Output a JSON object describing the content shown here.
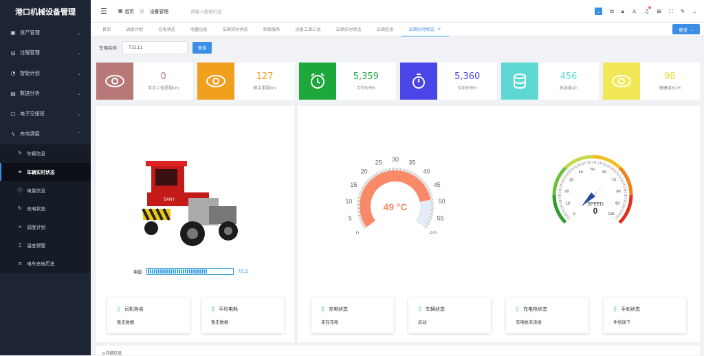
{
  "sidebar": {
    "logo": "港口机械设备管理",
    "menus": [
      {
        "label": "资产管理",
        "icon": "asset-icon",
        "chev": "⌄"
      },
      {
        "label": "过程管理",
        "icon": "process-icon",
        "chev": "⌄"
      },
      {
        "label": "智能计划",
        "icon": "plan-icon",
        "chev": "⌄"
      },
      {
        "label": "数据分析",
        "icon": "chart-icon",
        "chev": "⌄"
      },
      {
        "label": "电子交接班",
        "icon": "shift-icon",
        "chev": "⌄"
      },
      {
        "label": "充电调度",
        "icon": "charge-icon",
        "chev": "⌃"
      }
    ],
    "subs": [
      {
        "label": "车辆信息",
        "icon": "edit-icon"
      },
      {
        "label": "车辆实时状态",
        "icon": "glasses-icon"
      },
      {
        "label": "电量信息",
        "icon": "info-icon"
      },
      {
        "label": "充电状态",
        "icon": "refresh-icon"
      },
      {
        "label": "调度计划",
        "icon": "send-icon"
      },
      {
        "label": "温度预警",
        "icon": "bell-icon"
      },
      {
        "label": "电车充电历史",
        "icon": "list-icon"
      }
    ]
  },
  "topbar": {
    "crumb_home": "首页",
    "crumb_current": "设备管理",
    "search_placeholder": "请输入搜索内容"
  },
  "tabs": {
    "items": [
      "首页",
      "调度计划",
      "充电状态",
      "电量信息",
      "车辆实时状态",
      "检修服务",
      "设备工单汇总",
      "车辆实时状态",
      "车辆信息",
      "车辆实时状态"
    ],
    "active_index": 9,
    "more": "更多"
  },
  "filter": {
    "label": "车辆名称",
    "value": "T3111",
    "button": "查询"
  },
  "stats": [
    {
      "value": "0",
      "label": "单次上电里程km",
      "bg": "#b97878",
      "color": "#b97878"
    },
    {
      "value": "127",
      "label": "剩余里程km",
      "bg": "#f0a01e",
      "color": "#f0a01e"
    },
    {
      "value": "5,359",
      "label": "工作时长h",
      "bg": "#1ea83c",
      "color": "#1ea83c"
    },
    {
      "value": "5,360",
      "label": "待机时长h",
      "bg": "#4a45e6",
      "color": "#4a45e6"
    },
    {
      "value": "456",
      "label": "总容量Ah",
      "bg": "#5fd8d4",
      "color": "#5fd8d4"
    },
    {
      "value": "98",
      "label": "健康度SOH",
      "bg": "#f2e855",
      "color": "#e8d83a"
    }
  ],
  "vehicle": {
    "battery_label": "电量",
    "battery_value": "70.5",
    "battery_percent": 70.5,
    "truck_logo": "SANY"
  },
  "temp_gauge": {
    "value_text": "49 °C",
    "value": 49,
    "min": 0,
    "max": 60,
    "ticks": [
      "0",
      "5",
      "10",
      "15",
      "20",
      "25",
      "30",
      "35",
      "40",
      "45",
      "50",
      "55",
      "60"
    ]
  },
  "speed_gauge": {
    "label": "SPEED",
    "value_text": "0",
    "value": 0,
    "ticks": [
      "0",
      "10",
      "20",
      "30",
      "40",
      "50",
      "60",
      "70",
      "80",
      "90",
      "100"
    ]
  },
  "info_cards": [
    {
      "title": "司机姓名",
      "value": "暂无数据"
    },
    {
      "title": "平均电耗",
      "value": "暂无数据"
    },
    {
      "title": "充电状态",
      "value": "未在充电"
    },
    {
      "title": "车辆状态",
      "value": "启动"
    },
    {
      "title": "充电枪状态",
      "value": "充电枪未连接"
    },
    {
      "title": "手刹状态",
      "value": "手刹放下"
    }
  ],
  "bottom": {
    "label": "◎详细信息"
  }
}
